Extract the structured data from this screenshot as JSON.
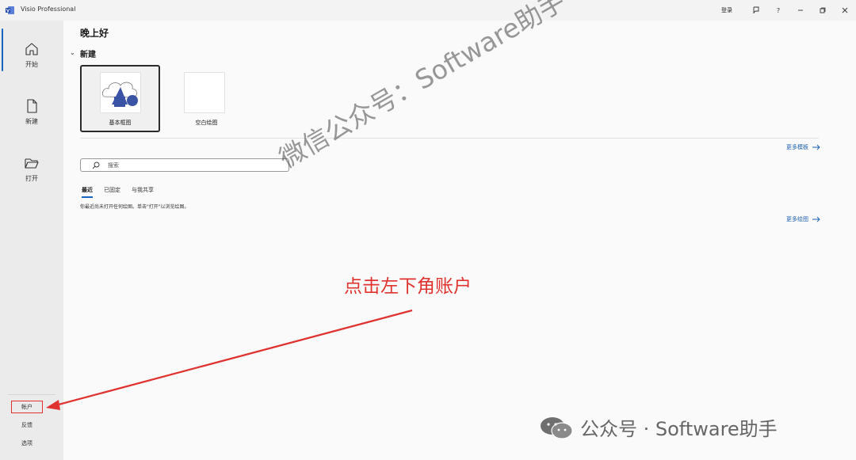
{
  "titlebar": {
    "app_title": "Visio Professional",
    "signin_label": "登录",
    "help_label": "?"
  },
  "sidebar": {
    "items": [
      {
        "label": "开始",
        "icon": "home-icon",
        "active": true
      },
      {
        "label": "新建",
        "icon": "new-file-icon"
      },
      {
        "label": "打开",
        "icon": "folder-open-icon"
      }
    ],
    "bottom_items": [
      {
        "label": "帐户"
      },
      {
        "label": "反馈"
      },
      {
        "label": "选项"
      }
    ]
  },
  "main": {
    "greeting": "晚上好",
    "new_section": {
      "heading": "新建",
      "templates": [
        {
          "label": "基本框图",
          "selected": true
        },
        {
          "label": "空白绘图"
        }
      ],
      "more_templates": "更多模板"
    },
    "search": {
      "placeholder": "搜索"
    },
    "tabs": [
      {
        "label": "最近",
        "active": true
      },
      {
        "label": "已固定"
      },
      {
        "label": "与我共享"
      }
    ],
    "empty_message": "你最近尚未打开任何绘图。单击\"打开\"以浏览绘图。",
    "more_drawings": "更多绘图"
  },
  "overlay": {
    "watermark": "微信公众号：Software助手",
    "annotation": "点击左下角账户",
    "footer_watermark": "公众号 · Software助手",
    "annotation_color": "#e0322f"
  },
  "colors": {
    "accent": "#1565c0",
    "link": "#1b5fae",
    "template_blue": "#3b53a4"
  }
}
